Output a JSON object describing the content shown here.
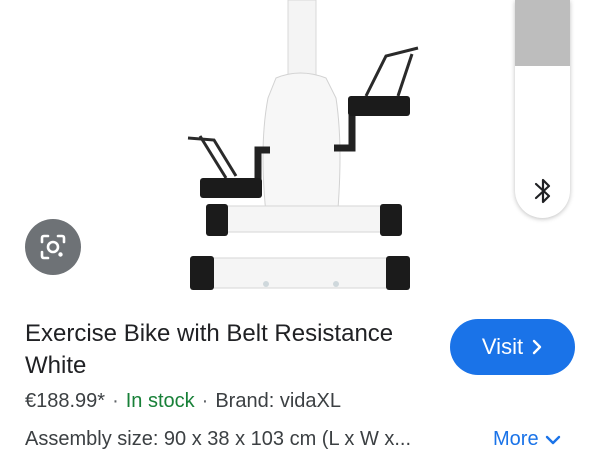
{
  "product": {
    "title": "Exercise Bike with Belt Resistance White",
    "price": "€188.99*",
    "separator": "·",
    "stock_status": "In stock",
    "brand": "Brand: vidaXL",
    "assembly": "Assembly size: 90 x 38 x 103 cm (L x W x..."
  },
  "actions": {
    "visit_label": "Visit",
    "more_label": "More"
  },
  "icons": {
    "lens": "google-lens-icon",
    "bluetooth": "bluetooth-icon",
    "visit_chevron": "chevron-right-icon",
    "more_chevron": "chevron-down-icon"
  },
  "colors": {
    "accent": "#1a73e8",
    "stock": "#188038",
    "text": "#202124"
  }
}
